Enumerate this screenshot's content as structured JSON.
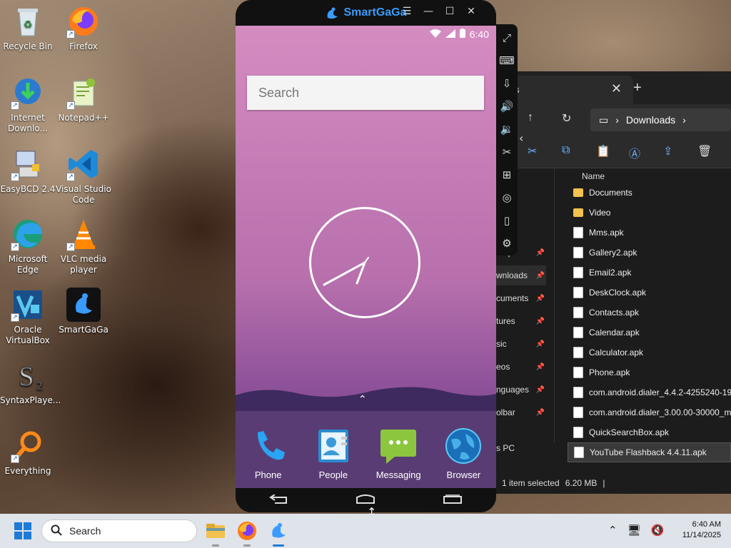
{
  "desktop": {
    "icons": [
      {
        "label": "Recycle Bin",
        "icon": "recycle-bin-icon"
      },
      {
        "label": "Firefox",
        "icon": "firefox-icon"
      },
      {
        "label": "Internet Downlo...",
        "icon": "idm-icon"
      },
      {
        "label": "Notepad++",
        "icon": "notepadpp-icon"
      },
      {
        "label": "EasyBCD 2.4",
        "icon": "easybcd-icon"
      },
      {
        "label": "Visual Studio Code",
        "icon": "vscode-icon"
      },
      {
        "label": "Microsoft Edge",
        "icon": "edge-icon"
      },
      {
        "label": "VLC media player",
        "icon": "vlc-icon"
      },
      {
        "label": "Oracle VirtualBox",
        "icon": "virtualbox-icon"
      },
      {
        "label": "SmartGaGa",
        "icon": "smartgaga-icon"
      },
      {
        "label": "SyntaxPlaye...",
        "icon": "syntaxplayer-icon"
      },
      {
        "label": "Everything",
        "icon": "everything-icon"
      }
    ]
  },
  "smartgaga": {
    "title": "SmartGaGa",
    "status": {
      "time": "6:40"
    },
    "search_placeholder": "Search",
    "dock": [
      {
        "label": "Phone",
        "icon": "phone-icon"
      },
      {
        "label": "People",
        "icon": "people-icon"
      },
      {
        "label": "Messaging",
        "icon": "messaging-icon"
      },
      {
        "label": "Browser",
        "icon": "browser-icon"
      }
    ]
  },
  "explorer": {
    "tab_label": "s",
    "breadcrumb": "Downloads",
    "column_name": "Name",
    "nav_items": [
      {
        "label": "...op"
      },
      {
        "label": "wnloads"
      },
      {
        "label": "cuments"
      },
      {
        "label": "tures"
      },
      {
        "label": "sic"
      },
      {
        "label": "eos"
      },
      {
        "label": "nguages"
      },
      {
        "label": "olbar"
      },
      {
        "label": "s PC"
      }
    ],
    "files": [
      {
        "name": "Documents",
        "type": "folder"
      },
      {
        "name": "Video",
        "type": "folder"
      },
      {
        "name": "Mms.apk",
        "type": "file"
      },
      {
        "name": "Gallery2.apk",
        "type": "file"
      },
      {
        "name": "Email2.apk",
        "type": "file"
      },
      {
        "name": "DeskClock.apk",
        "type": "file"
      },
      {
        "name": "Contacts.apk",
        "type": "file"
      },
      {
        "name": "Calendar.apk",
        "type": "file"
      },
      {
        "name": "Calculator.apk",
        "type": "file"
      },
      {
        "name": "Phone.apk",
        "type": "file"
      },
      {
        "name": "com.android.dialer_4.4.2-4255240-19_r",
        "type": "file"
      },
      {
        "name": "com.android.dialer_3.00.00-30000_min",
        "type": "file"
      },
      {
        "name": "QuickSearchBox.apk",
        "type": "file"
      },
      {
        "name": "YouTube Flashback 4.4.11.apk",
        "type": "file",
        "selected": true
      }
    ],
    "status": {
      "selection": "1 item selected",
      "size": "6.20 MB"
    }
  },
  "taskbar": {
    "search_label": "Search",
    "time": "6:40 AM",
    "date": "11/14/2025"
  },
  "colors": {
    "accent": "#1d7bd8",
    "smartgaga_brand": "#3a9bff",
    "folder": "#f2c14e"
  }
}
